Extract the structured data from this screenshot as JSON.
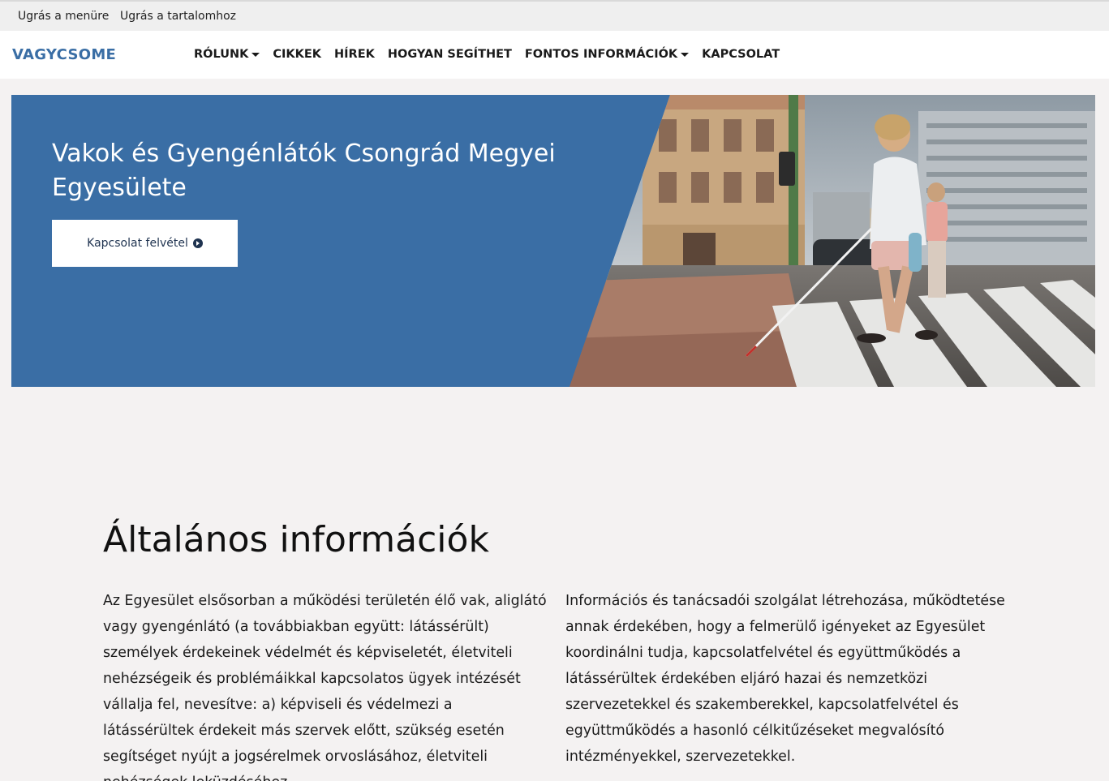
{
  "skip_links": {
    "menu": "Ugrás a menüre",
    "content": "Ugrás a tartalomhoz"
  },
  "navbar": {
    "brand": "VAGYCSOME",
    "items": [
      {
        "label": "RÓLUNK",
        "dropdown": true
      },
      {
        "label": "CIKKEK",
        "dropdown": false
      },
      {
        "label": "HÍREK",
        "dropdown": false
      },
      {
        "label": "HOGYAN SEGÍTHET",
        "dropdown": false
      },
      {
        "label": "FONTOS INFORMÁCIÓK",
        "dropdown": true
      },
      {
        "label": "KAPCSOLAT",
        "dropdown": false
      }
    ]
  },
  "hero": {
    "title": "Vakok és Gyengénlátók Csongrád Megyei Egyesülete",
    "button_label": "Kapcsolat felvétel",
    "button_icon": "play-circle-icon"
  },
  "section": {
    "title": "Általános információk",
    "paragraph_left": "Az Egyesület elsősorban a működési területén élő vak, aliglátó vagy gyengénlátó (a továbbiakban együtt: látássérült) személyek érdekeinek védelmét és képviseletét, életviteli nehézségeik és problémáikkal kapcsolatos ügyek intézését vállalja fel, nevesítve: a) képviseli és védelmezi a látássérültek érdekeit más szervek előtt, szükség esetén segítséget nyújt a jogsérelmek orvoslásához, életviteli nehézségek leküzdéséhez.",
    "paragraph_right": "Információs és tanácsadói szolgálat létrehozása, működtetése annak érdekében, hogy a felmerülő igényeket az Egyesület koordinálni tudja, kapcsolatfelvétel és együttműködés a látássérültek érdekében eljáró hazai és nemzetközi szervezetekkel és szakemberekkel, kapcsolatfelvétel és együttműködés a hasonló célkitűzéseket megvalósító intézményekkel, szervezetekkel."
  },
  "colors": {
    "brand_blue": "#3a6ea5",
    "page_background": "#f4f2f2"
  }
}
